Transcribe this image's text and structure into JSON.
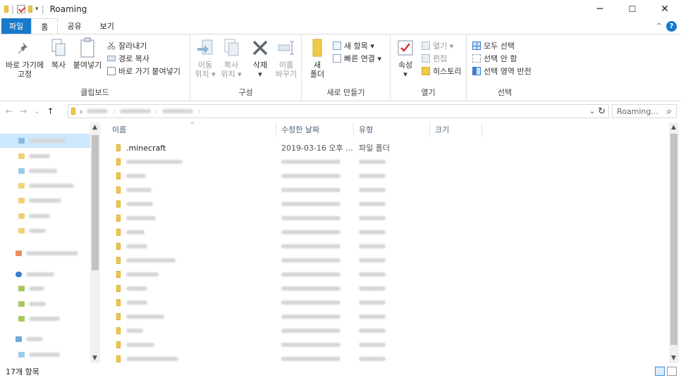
{
  "window": {
    "title": "Roaming",
    "controls": {
      "minimize": "─",
      "maximize": "☐",
      "close": "✕"
    },
    "qa_sep": "|",
    "qa_dropdown": "▾"
  },
  "ribbon_tabs": [
    "파일",
    "홈",
    "공유",
    "보기"
  ],
  "ribbon_right": {
    "collapse": "^",
    "help": "?"
  },
  "ribbon": {
    "clipboard": {
      "label": "클립보드",
      "pin": "바로 가기에\n고정",
      "copy": "복사",
      "paste": "붙여넣기",
      "cut": "잘라내기",
      "copy_path": "경로 복사",
      "paste_shortcut": "바로 가기 붙여넣기"
    },
    "organize": {
      "label": "구성",
      "move_to": "이동\n위치 ▾",
      "copy_to": "복사\n위치 ▾",
      "delete": "삭제\n▾",
      "rename": "이름\n바꾸기"
    },
    "new": {
      "label": "새로 만들기",
      "new_folder": "새\n폴더",
      "new_item": "새 항목 ▾",
      "easy_access": "빠른 연결 ▾"
    },
    "open": {
      "label": "열기",
      "properties": "속성\n▾",
      "open": "열기 ▾",
      "edit": "편집",
      "history": "히스토리"
    },
    "select": {
      "label": "선택",
      "select_all": "모두 선택",
      "select_none": "선택 안 함",
      "invert": "선택 영역 반전"
    }
  },
  "address": {
    "nav_back": "←",
    "nav_forward": "→",
    "nav_recent": "⌄",
    "nav_up": "↑",
    "crumb_sep": "›",
    "dropdown": "⌄",
    "refresh": "↻",
    "search_placeholder": "Roaming...",
    "search_icon": "⌕"
  },
  "columns": {
    "name": "이름",
    "date": "수정한 날짜",
    "type": "유형",
    "size": "크기",
    "sort_indicator": "^"
  },
  "files": [
    {
      "name": ".minecraft",
      "date": "2019-03-16 오후 ...",
      "type": "파일 폴더"
    }
  ],
  "status": {
    "count": "17개 항목"
  },
  "colors": {
    "accent": "#1979ca",
    "folder": "#f0c94a",
    "selection": "#cce8ff"
  }
}
